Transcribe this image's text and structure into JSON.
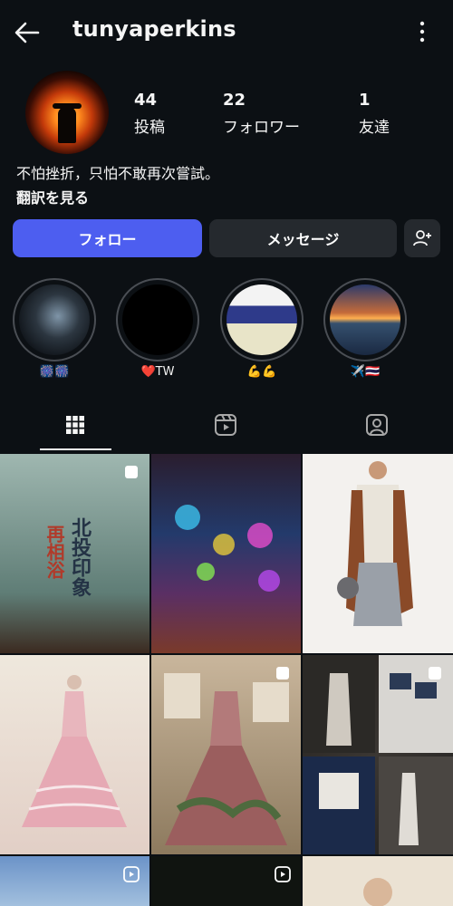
{
  "header": {
    "username": "tunyaperkins",
    "back_icon": "arrow-left-icon",
    "menu_icon": "more-vertical-icon"
  },
  "profile": {
    "stats": [
      {
        "value": "44",
        "label": "投稿"
      },
      {
        "value": "22",
        "label": "フォロワー"
      },
      {
        "value": "1",
        "label": "友達"
      }
    ],
    "bio": "不怕挫折，只怕不敢再次嘗試。",
    "translate_label": "翻訳を見る"
  },
  "actions": {
    "follow_label": "フォロー",
    "message_label": "メッセージ",
    "add_friend_icon": "person-add-icon",
    "follow_color": "#4d5ef0"
  },
  "highlights": [
    {
      "label": "🎆🎆"
    },
    {
      "label": "❤️TW"
    },
    {
      "label": "💪💪"
    },
    {
      "label": "✈️🇹🇭"
    }
  ],
  "tabs": [
    {
      "icon": "grid-icon",
      "active": true
    },
    {
      "icon": "reels-icon",
      "active": false
    },
    {
      "icon": "tagged-icon",
      "active": false
    }
  ],
  "posts": {
    "post1_text_a": "北投印象",
    "post1_text_b": "再相浴"
  }
}
